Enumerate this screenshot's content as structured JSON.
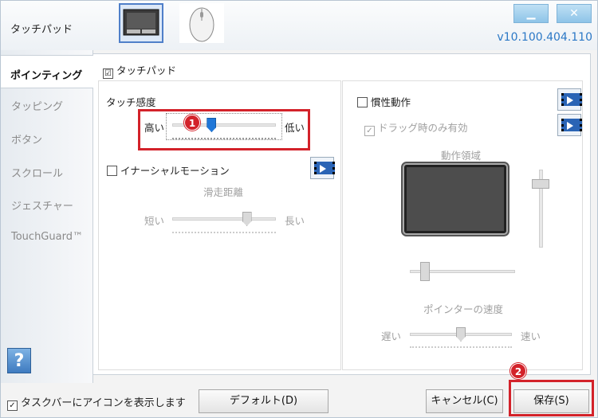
{
  "app_title": "タッチパッド",
  "version": "v10.100.404.110",
  "window_buttons": {
    "minimize": "▁",
    "close": "✕"
  },
  "sidebar": {
    "items": [
      {
        "label": "ポインティング",
        "active": true
      },
      {
        "label": "タッピング"
      },
      {
        "label": "ボタン"
      },
      {
        "label": "スクロール"
      },
      {
        "label": "ジェスチャー"
      },
      {
        "label": "TouchGuard™"
      }
    ],
    "help": "?"
  },
  "main": {
    "touchpad_checkbox": {
      "label": "タッチパッド",
      "checked": "☑"
    },
    "sensitivity": {
      "title": "タッチ感度",
      "left": "高い",
      "right": "低い",
      "value": 0.38
    },
    "inertial": {
      "label": "イナーシャルモーション",
      "slide_title": "滑走距離",
      "left": "短い",
      "right": "長い",
      "value": 0.72
    },
    "momentum": {
      "label": "慣性動作",
      "drag_only": "ドラッグ時のみ有効",
      "drag_check": "✓",
      "area_title": "動作領域"
    },
    "pointer_speed": {
      "title": "ポインターの速度",
      "left": "遅い",
      "right": "速い",
      "value": 0.5
    }
  },
  "annotations": {
    "badge1": "1",
    "badge2": "2",
    "color": "#d3222a"
  },
  "footer": {
    "taskbar_checkbox": "タスクバーにアイコンを表示します",
    "taskbar_check": "✓",
    "default_button": "デフォルト(D)",
    "cancel_button": "キャンセル(C)",
    "save_button": "保存(S)"
  }
}
